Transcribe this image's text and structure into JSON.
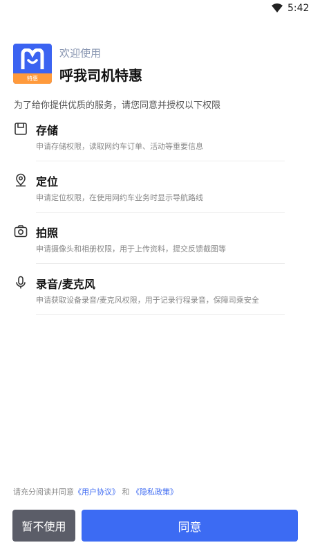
{
  "status_bar": {
    "time": "5:42",
    "wifi_icon": "wifi-icon"
  },
  "header": {
    "logo_badge": "特惠",
    "welcome": "欢迎使用",
    "app_name": "呼我司机特惠"
  },
  "intro": "为了给你提供优质的服务，请您同意并授权以下权限",
  "permissions": [
    {
      "icon": "storage-icon",
      "title": "存储",
      "desc": "申请存储权限，读取网约车订单、活动等重要信息"
    },
    {
      "icon": "location-icon",
      "title": "定位",
      "desc": "申请定位权限，在使用网约车业务时显示导航路线"
    },
    {
      "icon": "camera-icon",
      "title": "拍照",
      "desc": "申请摄像头和相册权限，用于上传资料，提交反馈截图等"
    },
    {
      "icon": "microphone-icon",
      "title": "录音/麦克风",
      "desc": "申请获取设备录音/麦克风权限，用于记录行程录音，保障司乘安全"
    }
  ],
  "agreement": {
    "prefix": "请充分阅读并同意",
    "user_agreement": "《用户协议》",
    "and": "和",
    "privacy_policy": "《隐私政策》"
  },
  "buttons": {
    "decline": "暂不使用",
    "agree": "同意"
  },
  "colors": {
    "accent": "#3c6bf3",
    "logo_orange": "#ff9a3c",
    "decline_bg": "#5b5d68"
  }
}
